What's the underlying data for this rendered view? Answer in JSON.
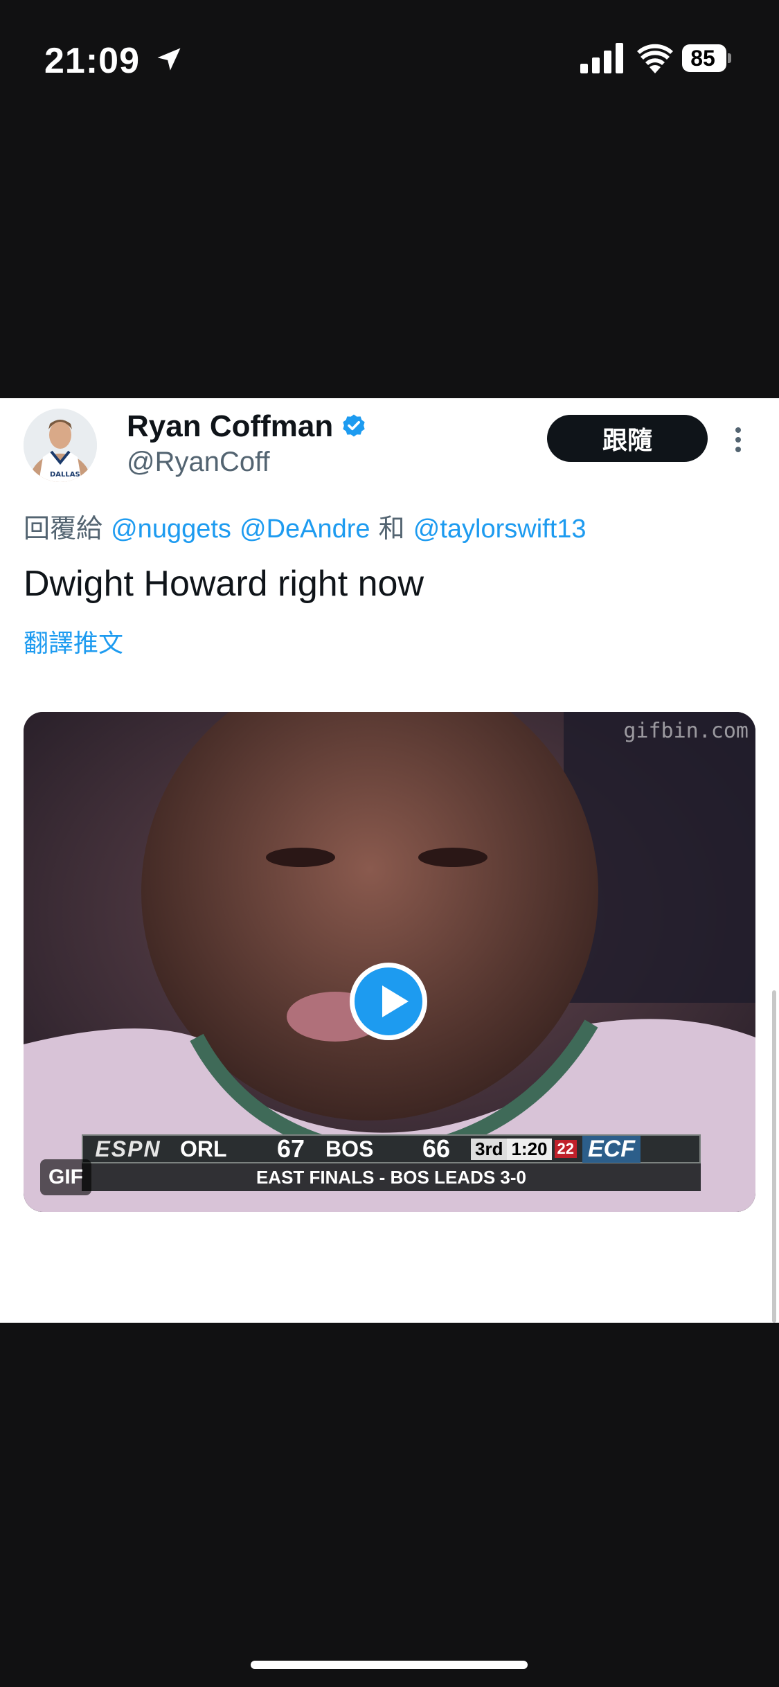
{
  "status_bar": {
    "time": "21:09",
    "battery": "85",
    "icons": [
      "location-arrow-icon",
      "signal-icon",
      "wifi-icon",
      "battery-icon"
    ]
  },
  "tweet": {
    "author_name": "Ryan Coffman",
    "handle": "@RyanCoff",
    "follow_label": "跟隨",
    "reply_prefix": "回覆給",
    "mentions": [
      "@nuggets",
      "@DeAndre",
      "@taylorswift13"
    ],
    "reply_joiner": "和",
    "text": "Dwight Howard right now",
    "translate_label": "翻譯推文",
    "media": {
      "badge": "GIF",
      "watermark": "gifbin.com",
      "scoreboard": {
        "network": "ESPN",
        "team1": "ORL",
        "score1": "67",
        "team2": "BOS",
        "score2": "66",
        "quarter": "3rd",
        "clock": "1:20",
        "shot_clock": "22",
        "series": "ECF",
        "subline": "EAST FINALS - BOS LEADS 3-0"
      }
    }
  },
  "colors": {
    "accent": "#1d9bf0",
    "text": "#0f1419",
    "muted": "#536471",
    "background": "#111112"
  }
}
